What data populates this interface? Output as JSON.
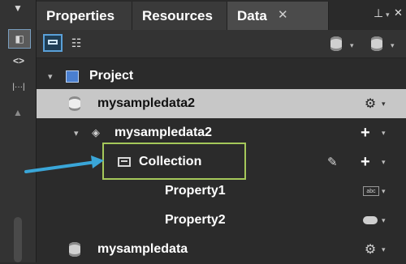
{
  "tabs": [
    {
      "label": "Properties",
      "active": false
    },
    {
      "label": "Resources",
      "active": false
    },
    {
      "label": "Data",
      "active": true
    }
  ],
  "tab_close_glyph": "✕",
  "pin_glyph": "⊥",
  "tree": {
    "project_label": "Project",
    "datasource_label": "mysampledata2",
    "datasource_child_label": "mysampledata2",
    "collection_label": "Collection",
    "property1_label": "Property1",
    "property2_label": "Property2",
    "datasource2_label": "mysampledata"
  },
  "icons": {
    "plus": "+",
    "dropdown": "▾"
  },
  "colors": {
    "highlight_box": "#a5c85a",
    "arrow": "#3aa6d8",
    "selected_row": "#c7c7c7",
    "background": "#2b2b2b"
  }
}
